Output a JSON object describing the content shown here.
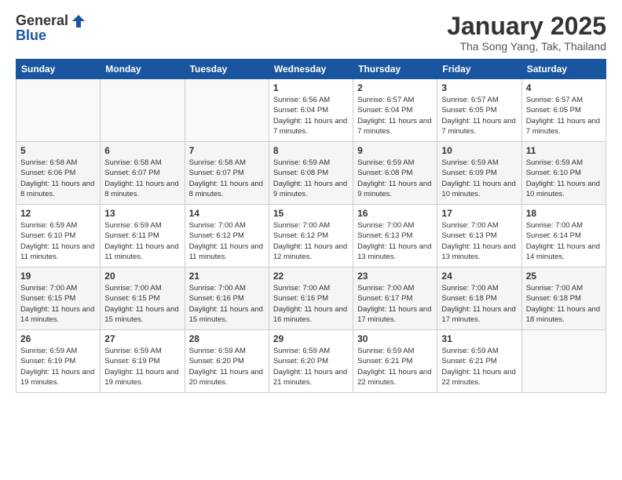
{
  "logo": {
    "general": "General",
    "blue": "Blue"
  },
  "title": "January 2025",
  "subtitle": "Tha Song Yang, Tak, Thailand",
  "days_of_week": [
    "Sunday",
    "Monday",
    "Tuesday",
    "Wednesday",
    "Thursday",
    "Friday",
    "Saturday"
  ],
  "weeks": [
    [
      {
        "day": "",
        "info": ""
      },
      {
        "day": "",
        "info": ""
      },
      {
        "day": "",
        "info": ""
      },
      {
        "day": "1",
        "sunrise": "Sunrise: 6:56 AM",
        "sunset": "Sunset: 6:04 PM",
        "daylight": "Daylight: 11 hours and 7 minutes."
      },
      {
        "day": "2",
        "sunrise": "Sunrise: 6:57 AM",
        "sunset": "Sunset: 6:04 PM",
        "daylight": "Daylight: 11 hours and 7 minutes."
      },
      {
        "day": "3",
        "sunrise": "Sunrise: 6:57 AM",
        "sunset": "Sunset: 6:05 PM",
        "daylight": "Daylight: 11 hours and 7 minutes."
      },
      {
        "day": "4",
        "sunrise": "Sunrise: 6:57 AM",
        "sunset": "Sunset: 6:05 PM",
        "daylight": "Daylight: 11 hours and 7 minutes."
      }
    ],
    [
      {
        "day": "5",
        "sunrise": "Sunrise: 6:58 AM",
        "sunset": "Sunset: 6:06 PM",
        "daylight": "Daylight: 11 hours and 8 minutes."
      },
      {
        "day": "6",
        "sunrise": "Sunrise: 6:58 AM",
        "sunset": "Sunset: 6:07 PM",
        "daylight": "Daylight: 11 hours and 8 minutes."
      },
      {
        "day": "7",
        "sunrise": "Sunrise: 6:58 AM",
        "sunset": "Sunset: 6:07 PM",
        "daylight": "Daylight: 11 hours and 8 minutes."
      },
      {
        "day": "8",
        "sunrise": "Sunrise: 6:59 AM",
        "sunset": "Sunset: 6:08 PM",
        "daylight": "Daylight: 11 hours and 9 minutes."
      },
      {
        "day": "9",
        "sunrise": "Sunrise: 6:59 AM",
        "sunset": "Sunset: 6:08 PM",
        "daylight": "Daylight: 11 hours and 9 minutes."
      },
      {
        "day": "10",
        "sunrise": "Sunrise: 6:59 AM",
        "sunset": "Sunset: 6:09 PM",
        "daylight": "Daylight: 11 hours and 10 minutes."
      },
      {
        "day": "11",
        "sunrise": "Sunrise: 6:59 AM",
        "sunset": "Sunset: 6:10 PM",
        "daylight": "Daylight: 11 hours and 10 minutes."
      }
    ],
    [
      {
        "day": "12",
        "sunrise": "Sunrise: 6:59 AM",
        "sunset": "Sunset: 6:10 PM",
        "daylight": "Daylight: 11 hours and 11 minutes."
      },
      {
        "day": "13",
        "sunrise": "Sunrise: 6:59 AM",
        "sunset": "Sunset: 6:11 PM",
        "daylight": "Daylight: 11 hours and 11 minutes."
      },
      {
        "day": "14",
        "sunrise": "Sunrise: 7:00 AM",
        "sunset": "Sunset: 6:12 PM",
        "daylight": "Daylight: 11 hours and 11 minutes."
      },
      {
        "day": "15",
        "sunrise": "Sunrise: 7:00 AM",
        "sunset": "Sunset: 6:12 PM",
        "daylight": "Daylight: 11 hours and 12 minutes."
      },
      {
        "day": "16",
        "sunrise": "Sunrise: 7:00 AM",
        "sunset": "Sunset: 6:13 PM",
        "daylight": "Daylight: 11 hours and 13 minutes."
      },
      {
        "day": "17",
        "sunrise": "Sunrise: 7:00 AM",
        "sunset": "Sunset: 6:13 PM",
        "daylight": "Daylight: 11 hours and 13 minutes."
      },
      {
        "day": "18",
        "sunrise": "Sunrise: 7:00 AM",
        "sunset": "Sunset: 6:14 PM",
        "daylight": "Daylight: 11 hours and 14 minutes."
      }
    ],
    [
      {
        "day": "19",
        "sunrise": "Sunrise: 7:00 AM",
        "sunset": "Sunset: 6:15 PM",
        "daylight": "Daylight: 11 hours and 14 minutes."
      },
      {
        "day": "20",
        "sunrise": "Sunrise: 7:00 AM",
        "sunset": "Sunset: 6:15 PM",
        "daylight": "Daylight: 11 hours and 15 minutes."
      },
      {
        "day": "21",
        "sunrise": "Sunrise: 7:00 AM",
        "sunset": "Sunset: 6:16 PM",
        "daylight": "Daylight: 11 hours and 15 minutes."
      },
      {
        "day": "22",
        "sunrise": "Sunrise: 7:00 AM",
        "sunset": "Sunset: 6:16 PM",
        "daylight": "Daylight: 11 hours and 16 minutes."
      },
      {
        "day": "23",
        "sunrise": "Sunrise: 7:00 AM",
        "sunset": "Sunset: 6:17 PM",
        "daylight": "Daylight: 11 hours and 17 minutes."
      },
      {
        "day": "24",
        "sunrise": "Sunrise: 7:00 AM",
        "sunset": "Sunset: 6:18 PM",
        "daylight": "Daylight: 11 hours and 17 minutes."
      },
      {
        "day": "25",
        "sunrise": "Sunrise: 7:00 AM",
        "sunset": "Sunset: 6:18 PM",
        "daylight": "Daylight: 11 hours and 18 minutes."
      }
    ],
    [
      {
        "day": "26",
        "sunrise": "Sunrise: 6:59 AM",
        "sunset": "Sunset: 6:19 PM",
        "daylight": "Daylight: 11 hours and 19 minutes."
      },
      {
        "day": "27",
        "sunrise": "Sunrise: 6:59 AM",
        "sunset": "Sunset: 6:19 PM",
        "daylight": "Daylight: 11 hours and 19 minutes."
      },
      {
        "day": "28",
        "sunrise": "Sunrise: 6:59 AM",
        "sunset": "Sunset: 6:20 PM",
        "daylight": "Daylight: 11 hours and 20 minutes."
      },
      {
        "day": "29",
        "sunrise": "Sunrise: 6:59 AM",
        "sunset": "Sunset: 6:20 PM",
        "daylight": "Daylight: 11 hours and 21 minutes."
      },
      {
        "day": "30",
        "sunrise": "Sunrise: 6:59 AM",
        "sunset": "Sunset: 6:21 PM",
        "daylight": "Daylight: 11 hours and 22 minutes."
      },
      {
        "day": "31",
        "sunrise": "Sunrise: 6:59 AM",
        "sunset": "Sunset: 6:21 PM",
        "daylight": "Daylight: 11 hours and 22 minutes."
      },
      {
        "day": "",
        "info": ""
      }
    ]
  ]
}
